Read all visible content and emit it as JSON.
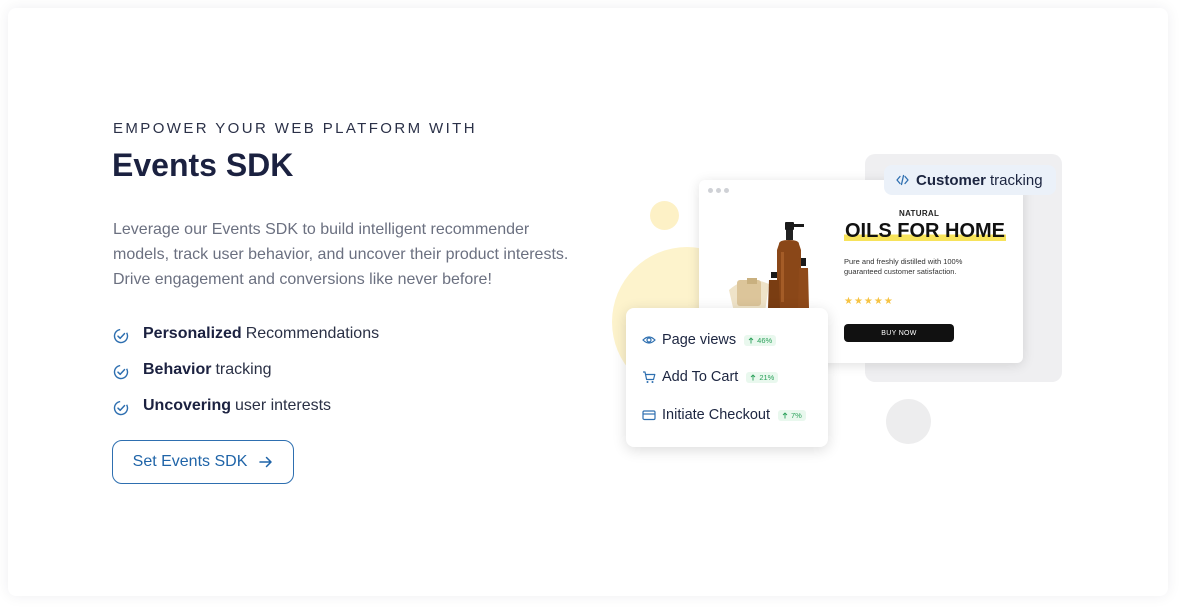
{
  "hero": {
    "eyebrow": "EMPOWER YOUR WEB PLATFORM WITH",
    "title": "Events SDK",
    "description": "Leverage our Events SDK to build intelligent recommender models, track user behavior, and uncover their product interests. Drive engagement and conversions like never before!",
    "features": [
      {
        "bold": "Personalized",
        "rest": "Recommendations",
        "icon": "check-circle-icon"
      },
      {
        "bold": "Behavior",
        "rest": "tracking",
        "icon": "check-circle-icon"
      },
      {
        "bold": "Uncovering",
        "rest": "user interests",
        "icon": "check-circle-icon"
      }
    ],
    "cta_label": "Set Events SDK"
  },
  "illustration": {
    "badge": {
      "bold": "Customer",
      "rest": "tracking",
      "icon": "code-icon"
    },
    "product": {
      "brand": "NATURAL",
      "title": "OILS FOR HOME",
      "description": "Pure and freshly distilled with 100% guaranteed customer satisfaction.",
      "stars": "★★★★★",
      "rating": 5,
      "buy_label": "BUY NOW"
    },
    "events": [
      {
        "label": "Page views",
        "change": "46%",
        "icon": "eye-icon"
      },
      {
        "label": "Add To Cart",
        "change": "21%",
        "icon": "cart-icon"
      },
      {
        "label": "Initiate Checkout",
        "change": "7%",
        "icon": "credit-card-icon"
      }
    ]
  },
  "colors": {
    "accent": "#1f64a8",
    "heading": "#1b2140",
    "highlight": "#f7e35b",
    "positive": "#2aa05a"
  }
}
